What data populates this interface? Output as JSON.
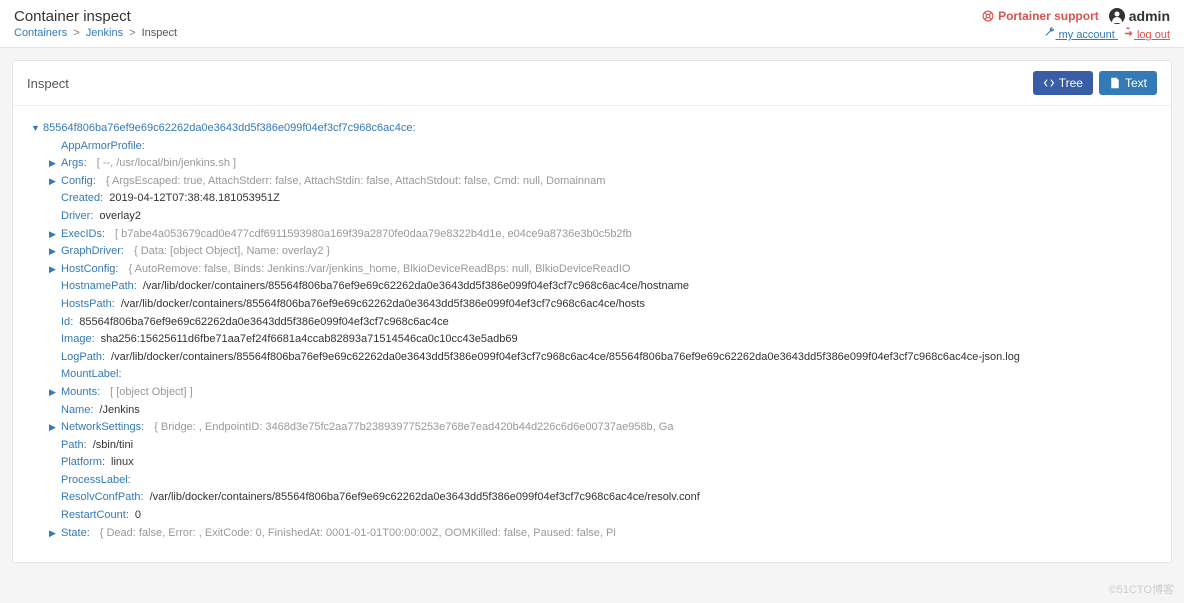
{
  "header": {
    "title": "Container inspect",
    "crumbs": {
      "root": "Containers",
      "mid": "Jenkins",
      "cur": "Inspect"
    },
    "support": "Portainer support",
    "user": "admin",
    "myaccount": "my account",
    "logout": "log out"
  },
  "panel": {
    "title": "Inspect",
    "btn_tree": "Tree",
    "btn_text": "Text"
  },
  "tree": {
    "id": "85564f806ba76ef9e69c62262da0e3643dd5f386e099f04ef3cf7c968c6ac4ce",
    "AppArmorProfile": {
      "label": "AppArmorProfile"
    },
    "Args": {
      "label": "Args",
      "preview": "[ --, /usr/local/bin/jenkins.sh ]"
    },
    "Config": {
      "label": "Config",
      "preview": "{ ArgsEscaped: true, AttachStderr: false, AttachStdin: false, AttachStdout: false, Cmd: null, Domainnam"
    },
    "Created": {
      "label": "Created",
      "value": "2019-04-12T07:38:48.181053951Z"
    },
    "Driver": {
      "label": "Driver",
      "value": "overlay2"
    },
    "ExecIDs": {
      "label": "ExecIDs",
      "preview": "[ b7abe4a053679cad0e477cdf6911593980a169f39a2870fe0daa79e8322b4d1e, e04ce9a8736e3b0c5b2fb"
    },
    "GraphDriver": {
      "label": "GraphDriver",
      "preview": "{ Data: [object Object], Name: overlay2 }"
    },
    "HostConfig": {
      "label": "HostConfig",
      "preview": "{ AutoRemove: false, Binds: Jenkins:/var/jenkins_home, BlkioDeviceReadBps: null, BlkioDeviceReadIO"
    },
    "HostnamePath": {
      "label": "HostnamePath",
      "value": "/var/lib/docker/containers/85564f806ba76ef9e69c62262da0e3643dd5f386e099f04ef3cf7c968c6ac4ce/hostname"
    },
    "HostsPath": {
      "label": "HostsPath",
      "value": "/var/lib/docker/containers/85564f806ba76ef9e69c62262da0e3643dd5f386e099f04ef3cf7c968c6ac4ce/hosts"
    },
    "Id": {
      "label": "Id",
      "value": "85564f806ba76ef9e69c62262da0e3643dd5f386e099f04ef3cf7c968c6ac4ce"
    },
    "Image": {
      "label": "Image",
      "value": "sha256:15625611d6fbe71aa7ef24f6681a4ccab82893a71514546ca0c10cc43e5adb69"
    },
    "LogPath": {
      "label": "LogPath",
      "value": "/var/lib/docker/containers/85564f806ba76ef9e69c62262da0e3643dd5f386e099f04ef3cf7c968c6ac4ce/85564f806ba76ef9e69c62262da0e3643dd5f386e099f04ef3cf7c968c6ac4ce-json.log"
    },
    "MountLabel": {
      "label": "MountLabel"
    },
    "Mounts": {
      "label": "Mounts",
      "preview": "[ [object Object] ]"
    },
    "Name": {
      "label": "Name",
      "value": "/Jenkins"
    },
    "NetworkSettings": {
      "label": "NetworkSettings",
      "preview": "{ Bridge: , EndpointID: 3468d3e75fc2aa77b238939775253e768e7ead420b44d226c6d6e00737ae958b, Ga"
    },
    "Path": {
      "label": "Path",
      "value": "/sbin/tini"
    },
    "Platform": {
      "label": "Platform",
      "value": "linux"
    },
    "ProcessLabel": {
      "label": "ProcessLabel"
    },
    "ResolvConfPath": {
      "label": "ResolvConfPath",
      "value": "/var/lib/docker/containers/85564f806ba76ef9e69c62262da0e3643dd5f386e099f04ef3cf7c968c6ac4ce/resolv.conf"
    },
    "RestartCount": {
      "label": "RestartCount",
      "value": "0"
    },
    "State": {
      "label": "State",
      "preview": "{ Dead: false, Error: , ExitCode: 0, FinishedAt: 0001-01-01T00:00:00Z, OOMKilled: false, Paused: false, Pi"
    }
  },
  "watermark": "©51CTO博客"
}
